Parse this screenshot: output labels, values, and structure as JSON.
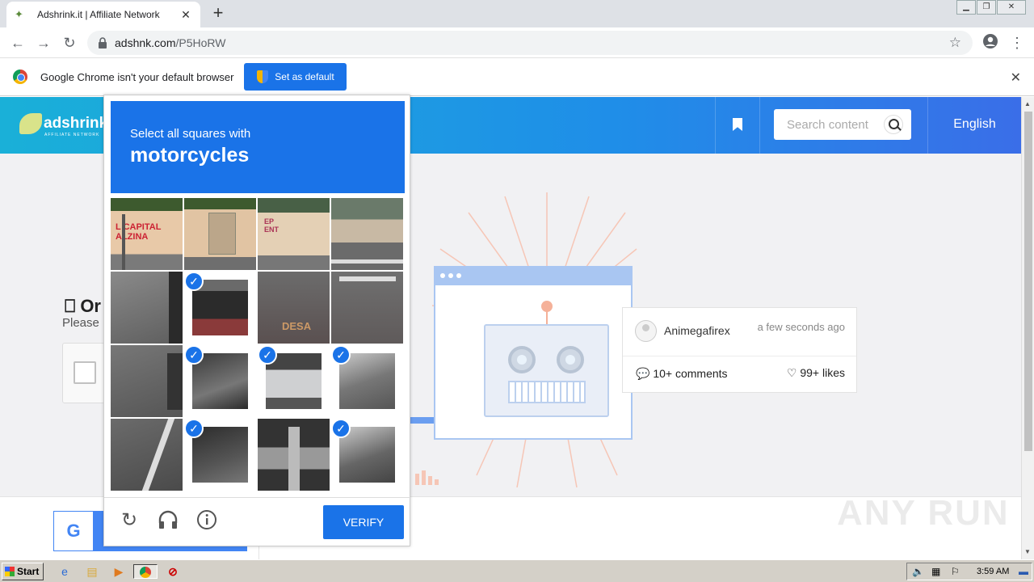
{
  "browser": {
    "tab_title": "Adshrink.it | Affiliate Network",
    "url_host": "adshnk.com",
    "url_path": "/P5HoRW",
    "infobar_text": "Google Chrome isn't your default browser",
    "set_default_label": "Set as default"
  },
  "site": {
    "logo_text": "adshrink.it",
    "logo_sub": "AFFILIATE NETWORK",
    "search_placeholder": "Search content",
    "language": "English",
    "captcha_title_partial": "Or",
    "captcha_sub_partial": "Please"
  },
  "card": {
    "user": "Animegafirex",
    "time": "a few seconds ago",
    "comments": "10+ comments",
    "likes": "99+ likes"
  },
  "challenge": {
    "instruction": "Select all squares with",
    "target": "motorcycles",
    "verify_label": "VERIFY",
    "selected_tiles": [
      5,
      9,
      10,
      11,
      13,
      15
    ]
  },
  "watermark": "ANY RUN",
  "taskbar": {
    "start_label": "Start",
    "clock": "3:59 AM"
  }
}
